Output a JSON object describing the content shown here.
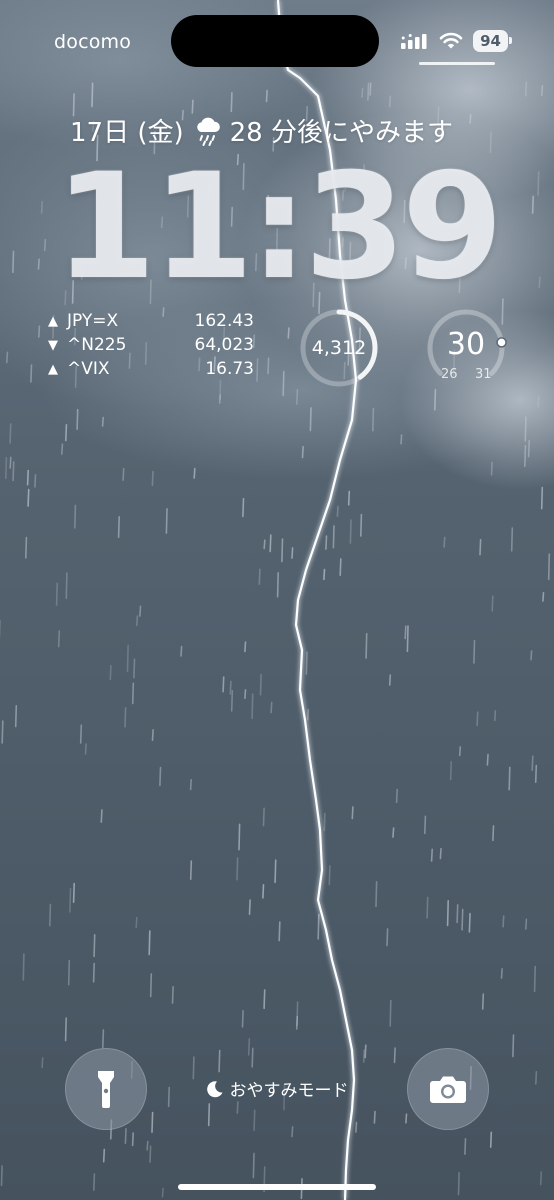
{
  "status_bar": {
    "carrier": "docomo",
    "battery": "94"
  },
  "lock_screen": {
    "date": "17日 (金)",
    "weather_note": "28 分後にやみます",
    "time": "11:39"
  },
  "stocks": [
    {
      "direction": "up",
      "arrow": "▲",
      "symbol": "JPY=X",
      "value": "162.43"
    },
    {
      "direction": "down",
      "arrow": "▼",
      "symbol": "^N225",
      "value": "64,023"
    },
    {
      "direction": "up",
      "arrow": "▲",
      "symbol": "^VIX",
      "value": "16.73"
    }
  ],
  "steps_widget": {
    "value": "4,312",
    "progress": 0.4
  },
  "temperature_widget": {
    "current": "30",
    "low": "26",
    "high": "31",
    "level": 0.8
  },
  "bottom": {
    "focus_mode": "おやすみモード"
  },
  "colors": {
    "background": "#556370",
    "text": "#ffffff",
    "battery_badge": "#f1f3f5"
  },
  "icons": {
    "weather": "cloud-rain-icon",
    "flashlight": "flashlight-icon",
    "camera": "camera-icon",
    "focus": "moon-icon",
    "signal": "cellular-signal-icon",
    "wifi": "wifi-icon",
    "battery": "battery-icon"
  }
}
